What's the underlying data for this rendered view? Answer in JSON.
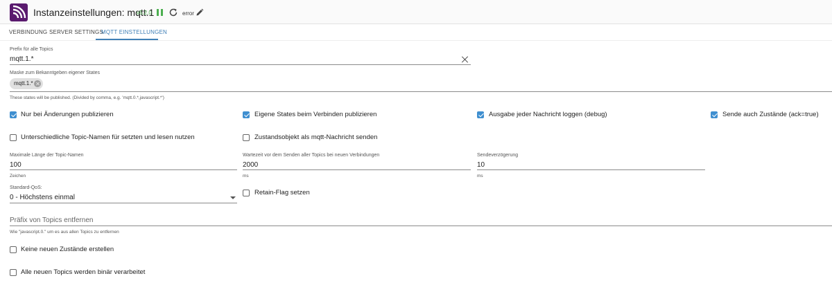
{
  "header": {
    "title": "Instanzeinstellungen: mqtt.1",
    "version": "v5.2.0",
    "status": "error",
    "logo_color": "#5a1a6e"
  },
  "tabs": [
    {
      "label": "VERBINDUNG"
    },
    {
      "label": "SERVER SETTINGS"
    },
    {
      "label": "MQTT EINSTELLUNGEN",
      "active": true
    }
  ],
  "prefix": {
    "label": "Prefix für alle Topics",
    "value": "mqtt.1.*"
  },
  "mask": {
    "label": "Maske zum Bekanntgeben eigener States",
    "chip": "mqtt.1.*",
    "helper": "These states will be published. (Divided by comma, e.g. 'mqtt.0.*,javascript.*')"
  },
  "checkboxes": {
    "only_changes": {
      "label": "Nur bei Änderungen publizieren",
      "checked": true
    },
    "publish_on_connect": {
      "label": "Eigene States beim Verbinden publizieren",
      "checked": true
    },
    "debug_log": {
      "label": "Ausgabe jeder Nachricht loggen (debug)",
      "checked": true
    },
    "send_ack": {
      "label": "Sende auch Zustände (ack=true)",
      "checked": true
    },
    "different_topics": {
      "label": "Unterschiedliche Topic-Namen für setzten und lesen nutzen",
      "checked": false
    },
    "state_object": {
      "label": "Zustandsobjekt als mqtt-Nachricht senden",
      "checked": false
    },
    "retain": {
      "label": "Retain-Flag setzen",
      "checked": false
    },
    "no_new_states": {
      "label": "Keine neuen Zustände erstellen",
      "checked": false
    },
    "binary": {
      "label": "Alle neuen Topics werden binär verarbeitet",
      "checked": false
    }
  },
  "max_topic_length": {
    "label": "Maximale Länge der Topic-Namen",
    "value": "100",
    "helper": "Zeichen"
  },
  "wait_time": {
    "label": "Wartezeit vor dem Senden aller Topics bei neuen Verbindungen",
    "value": "2000",
    "helper": "ms"
  },
  "send_delay": {
    "label": "Sendeverzögerung",
    "value": "10",
    "helper": "ms"
  },
  "qos": {
    "label": "Standard-QoS:",
    "value": "0 - Höchstens einmal"
  },
  "remove_prefix": {
    "placeholder": "Präfix von Topics entfernen",
    "helper": "Wie \"javascript.0.\" um es aus allen Topics zu entfernen"
  },
  "accent_color": "#3f7fb6"
}
